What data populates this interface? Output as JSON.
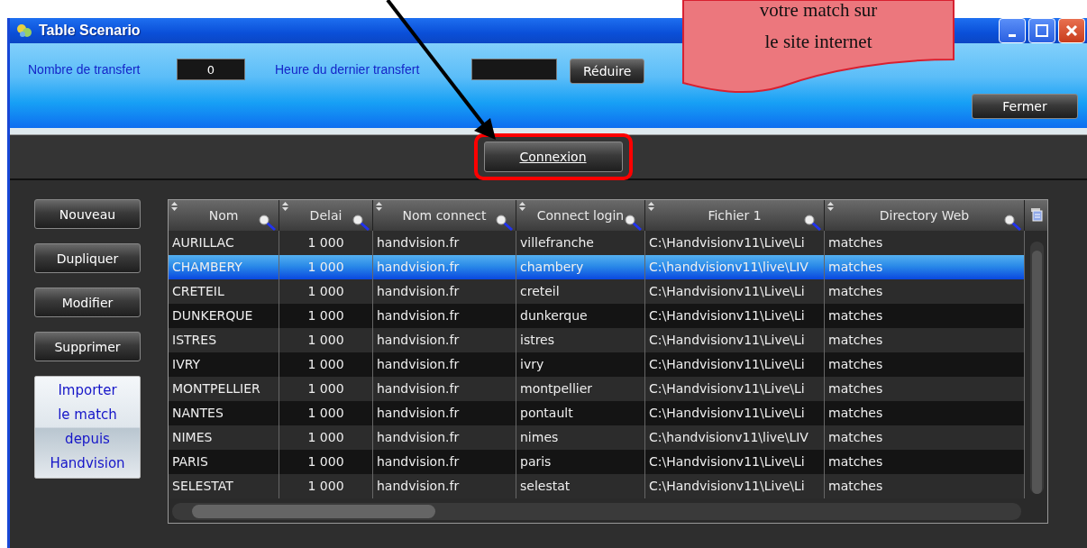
{
  "window": {
    "title": "Table Scenario"
  },
  "toolbar": {
    "transfer_count_label": "Nombre de transfert",
    "transfer_count": "0",
    "last_transfer_label": "Heure du dernier transfert",
    "reduce_button": "Réduire",
    "close_button": "Fermer"
  },
  "connect_button": "Connexion",
  "side_buttons": [
    "Nouveau",
    "Dupliquer",
    "Modifier",
    "Supprimer"
  ],
  "import_button": [
    "Importer",
    "le match",
    "depuis",
    "Handvision"
  ],
  "table": {
    "columns": [
      "Nom",
      "Delai",
      "Nom connect",
      "Connect login",
      "Fichier 1",
      "Directory Web"
    ],
    "rows": [
      {
        "cells": [
          "AURILLAC",
          "1 000",
          "handvision.fr",
          "villefranche",
          "C:\\Handvisionv11\\Live\\Li",
          "matches"
        ],
        "selected": false
      },
      {
        "cells": [
          "CHAMBERY",
          "1 000",
          "handvision.fr",
          "chambery",
          "C:\\handvisionv11\\live\\LIV",
          "matches"
        ],
        "selected": true
      },
      {
        "cells": [
          "CRETEIL",
          "1 000",
          "handvision.fr",
          "creteil",
          "C:\\Handvisionv11\\Live\\Li",
          "matches"
        ],
        "selected": false
      },
      {
        "cells": [
          "DUNKERQUE",
          "1 000",
          "handvision.fr",
          "dunkerque",
          "C:\\Handvisionv11\\Live\\Li",
          "matches"
        ],
        "selected": false
      },
      {
        "cells": [
          "ISTRES",
          "1 000",
          "handvision.fr",
          "istres",
          "C:\\Handvisionv11\\Live\\Li",
          "matches"
        ],
        "selected": false
      },
      {
        "cells": [
          "IVRY",
          "1 000",
          "handvision.fr",
          "ivry",
          "C:\\Handvisionv11\\Live\\Li",
          "matches"
        ],
        "selected": false
      },
      {
        "cells": [
          "MONTPELLIER",
          "1 000",
          "handvision.fr",
          "montpellier",
          "C:\\Handvisionv11\\Live\\Li",
          "matches"
        ],
        "selected": false
      },
      {
        "cells": [
          "NANTES",
          "1 000",
          "handvision.fr",
          "pontault",
          "C:\\Handvisionv11\\Live\\Li",
          "matches"
        ],
        "selected": false
      },
      {
        "cells": [
          "NIMES",
          "1 000",
          "handvision.fr",
          "nimes",
          "C:\\handvisionv11\\live\\LIV",
          "matches"
        ],
        "selected": false
      },
      {
        "cells": [
          "PARIS",
          "1 000",
          "handvision.fr",
          "paris",
          "C:\\Handvisionv11\\Live\\Li",
          "matches"
        ],
        "selected": false
      },
      {
        "cells": [
          "SELESTAT",
          "1 000",
          "handvision.fr",
          "selestat",
          "C:\\Handvisionv11\\Live\\Li",
          "matches"
        ],
        "selected": false
      }
    ]
  },
  "callout": {
    "lines": [
      "votre match sur",
      "le site internet"
    ]
  }
}
